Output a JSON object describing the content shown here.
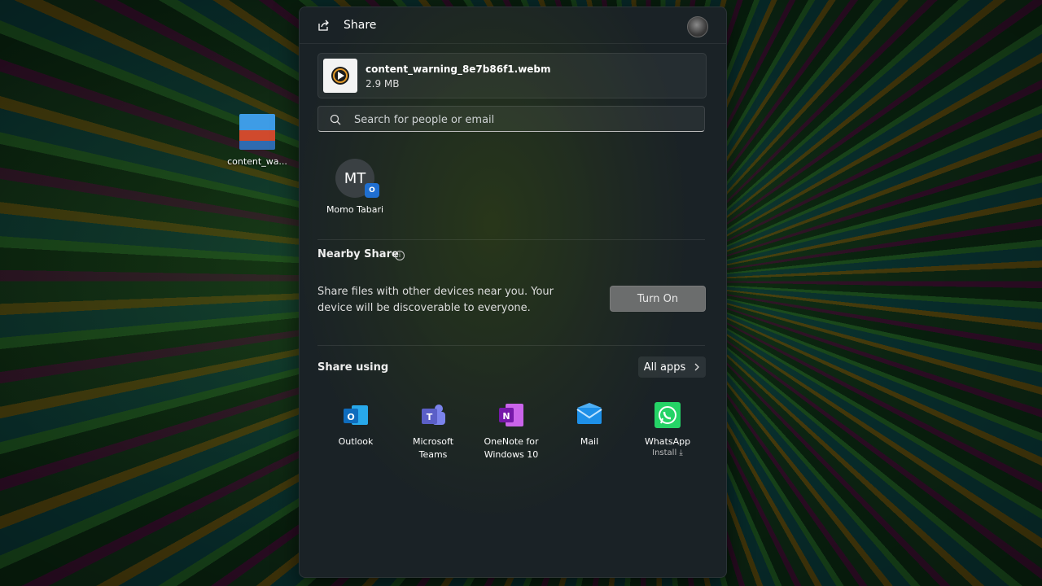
{
  "desktop": {
    "icon_label": "content_wa..."
  },
  "panel": {
    "title": "Share",
    "file": {
      "name": "content_warning_8e7b86f1.webm",
      "size": "2.9 MB"
    },
    "search": {
      "placeholder": "Search for people or email"
    },
    "contacts": [
      {
        "initials": "MT",
        "name": "Momo Tabari",
        "badge": "O"
      }
    ],
    "nearby": {
      "title": "Nearby Share",
      "description": "Share files with other devices near you. Your device will be discoverable to everyone.",
      "button": "Turn On"
    },
    "share_using": {
      "title": "Share using",
      "all_apps": "All apps",
      "apps": [
        {
          "label": "Outlook",
          "icon": "outlook-icon",
          "color": "#0f6cbd"
        },
        {
          "label": "Microsoft Teams",
          "icon": "teams-icon",
          "color": "#5b5fc7"
        },
        {
          "label": "OneNote for Windows 10",
          "icon": "onenote-icon",
          "color": "#7719aa"
        },
        {
          "label": "Mail",
          "icon": "mail-icon",
          "color": "#1e90e8"
        },
        {
          "label": "WhatsApp",
          "sub": "Install ⤓",
          "icon": "whatsapp-icon",
          "color": "#25d366"
        }
      ]
    }
  }
}
